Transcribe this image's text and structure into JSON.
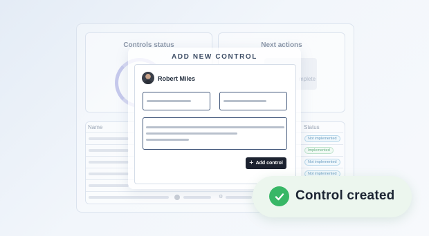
{
  "background": {
    "controls_status": {
      "title": "Controls status"
    },
    "next_actions": {
      "title": "Next actions",
      "item_text": "mplete"
    },
    "table": {
      "headers": {
        "name": "Name",
        "status": "Status"
      },
      "statuses": [
        "Not implemented",
        "Implemented",
        "Not implemented",
        "Not implemented"
      ]
    }
  },
  "modal": {
    "title": "ADD NEW CONTROL",
    "user_name": "Robert Miles",
    "submit_label": "Add control"
  },
  "toast": {
    "message": "Control created"
  },
  "colors": {
    "accent_dark": "#1c2230",
    "success": "#38b766",
    "toast_bg": "#ecf6ee",
    "field_border": "#41577a"
  }
}
